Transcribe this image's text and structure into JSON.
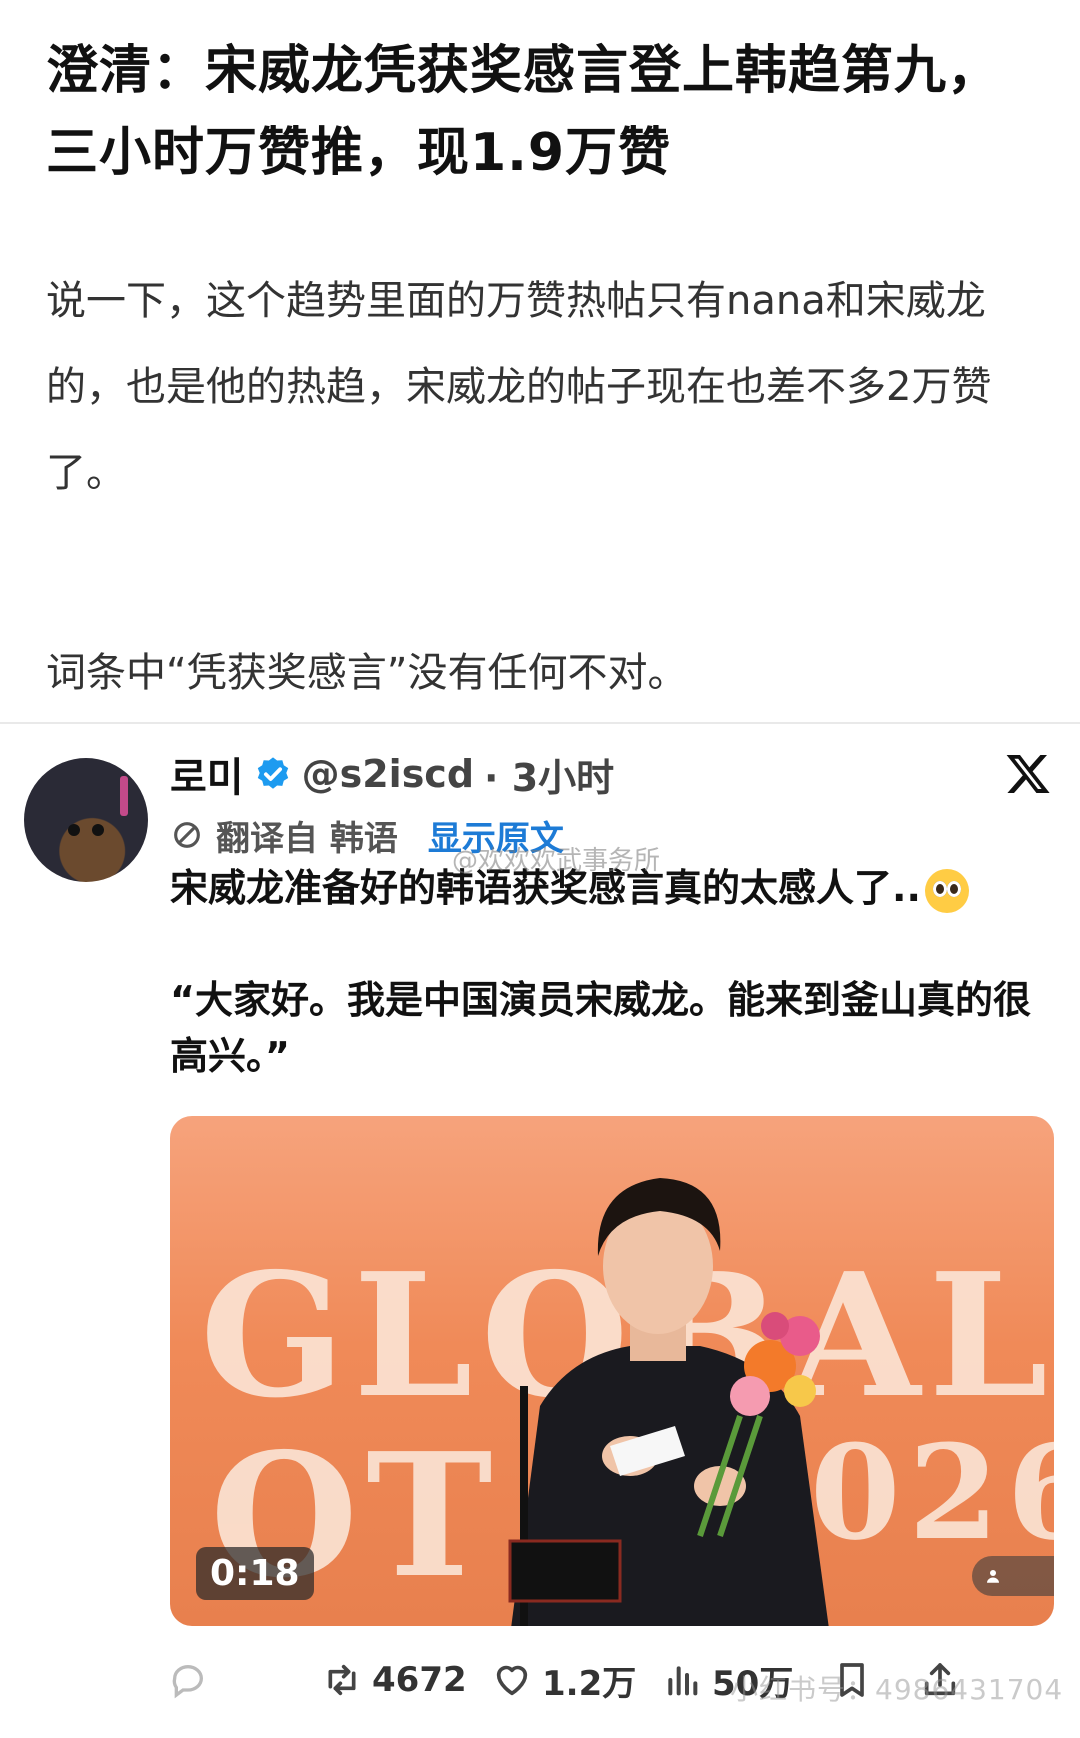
{
  "article": {
    "title": "澄清：宋威龙凭获奖感言登上韩趋第九，三小时万赞推，现1.9万赞",
    "paragraph1": "说一下，这个趋势里面的万赞热帖只有nana和宋威龙的，也是他的热趋，宋威龙的帖子现在也差不多2万赞了。",
    "paragraph2": "词条中“凭获奖感言”没有任何不对。"
  },
  "tweet": {
    "display_name": "로미",
    "handle": "@s2iscd",
    "time": "· 3小时",
    "translated_from": "翻译自 韩语",
    "show_original": "显示原文",
    "text_line1": "宋威龙准备好的韩语获奖感言真的太感人了..",
    "text_line2": "“大家好。我是中国演员宋威龙。能来到釜山真的很高兴。”",
    "media": {
      "duration": "0:18",
      "background_text_1": "GLOBAL",
      "background_text_2": "OT",
      "background_text_3": "026"
    },
    "stats": {
      "retweets": "4672",
      "likes": "1.2万",
      "views": "50万"
    }
  },
  "watermarks": {
    "weibo": "@欢欢欢武事务所",
    "xiaohongshu": "小红书号：4986431704"
  },
  "colors": {
    "link_blue": "#1d7bd6",
    "verified_blue": "#1d9bf0",
    "media_orange": "#f08a58"
  }
}
